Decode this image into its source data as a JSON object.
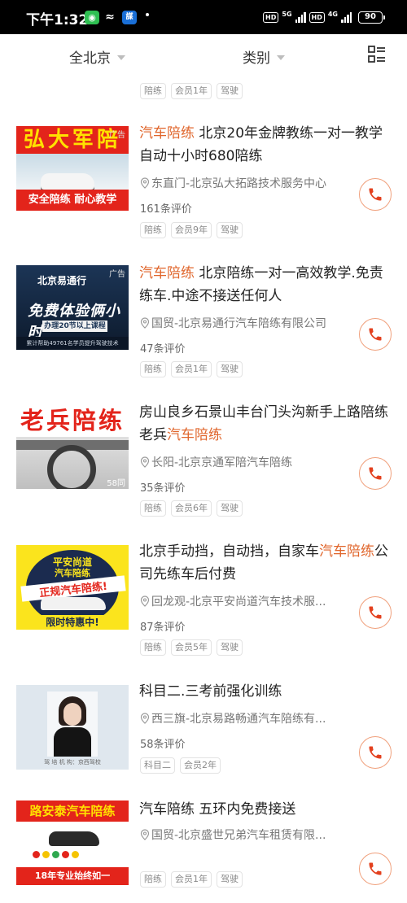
{
  "status_bar": {
    "time": "下午1:32",
    "app_box_label": "謀",
    "hd1": "HD",
    "net1": "5G",
    "hd2": "HD",
    "net2": "4G",
    "battery": "90"
  },
  "filters": {
    "city": "全北京",
    "category": "类别"
  },
  "top_tags": [
    "陪练",
    "会员1年",
    "驾驶"
  ],
  "listings": [
    {
      "title_highlight": "汽车陪练",
      "title_rest": " 北京20年金牌教练一对一教学自动十小时680陪练",
      "location": "东直门-北京弘大拓路技术服务中心",
      "reviews": "161条评价",
      "tags": [
        "陪练",
        "会员9年",
        "驾驶"
      ],
      "ad_label": "广告",
      "thumb": {
        "banner": "弘大军陪",
        "footer": "安全陪练 耐心教学"
      }
    },
    {
      "title_highlight": "汽车陪练",
      "title_rest": " 北京陪练一对一高效教学.免责练车.中途不接送任何人",
      "location": "国贸-北京易通行汽车陪练有限公司",
      "reviews": "47条评价",
      "tags": [
        "陪练",
        "会员1年",
        "驾驶"
      ],
      "ad_label": "广告",
      "thumb": {
        "brand": "北京易通行",
        "headline": "免费体验俩小时",
        "sub": "办理20节以上课程",
        "footer": "累计帮助49761名学员提升驾驶技术"
      }
    },
    {
      "title_before": "房山良乡石景山丰台门头沟新手上路陪练老兵",
      "title_highlight": "汽车陪练",
      "location": "长阳-北京京通军陪汽车陪练",
      "reviews": "35条评价",
      "tags": [
        "陪练",
        "会员6年",
        "驾驶"
      ],
      "thumb": {
        "banner": "老兵陪练",
        "corner": "58同"
      }
    },
    {
      "title_before": "北京手动挡，自动挡，自家车",
      "title_highlight": "汽车陪练",
      "title_after": "公司先练车后付费",
      "location": "回龙观-北京平安尚道汽车技术服...",
      "reviews": "87条评价",
      "tags": [
        "陪练",
        "会员5年",
        "驾驶"
      ],
      "thumb": {
        "l1": "平安尚道",
        "l2": "汽车陪练",
        "l3": "正规汽车陪练!",
        "l4": "限时特惠中!"
      }
    },
    {
      "title_plain": "科目二.三考前强化训练",
      "location": "西三旗-北京易路畅通汽车陪练有...",
      "reviews": "58条评价",
      "tags": [
        "科目二",
        "会员2年"
      ],
      "thumb": {
        "caption": "驾 培 机 构：京西驾校"
      }
    },
    {
      "title_plain": "汽车陪练 五环内免费接送",
      "location": "国贸-北京盛世兄弟汽车租赁有限...",
      "tags": [
        "陪练",
        "会员1年",
        "驾驶"
      ],
      "thumb": {
        "banner": "路安泰汽车陪练",
        "footer": "18年专业始终如一"
      }
    }
  ],
  "colors": {
    "accent": "#e0662c",
    "call_border": "#f0a07c",
    "status_bar": "#000000"
  },
  "icons": {
    "view_toggle": "list-grid-icon",
    "location": "location-pin-icon",
    "call": "phone-icon"
  }
}
